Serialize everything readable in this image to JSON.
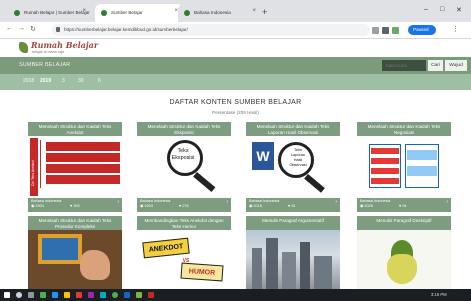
{
  "browser": {
    "tabs": [
      {
        "label": "Rumah Belajar | Sumber Belajar"
      },
      {
        "label": "Sumber Belajar"
      },
      {
        "label": "Bahasa Indonesia"
      }
    ],
    "new_tab": "+",
    "window_controls": {
      "minimize": "–",
      "maximize": "□",
      "close": "✕"
    },
    "url": "https://sumberbelajar.belajar.kemdikbud.go.id/sumberbelajar/",
    "profile_label": "Paused"
  },
  "site": {
    "logo_text": "Rumah Belajar",
    "logo_sub": "belajar di mana saja",
    "title": "SUMBER BELAJAR",
    "search_placeholder": "Kata Kunci",
    "search_button": "Cari",
    "filter_button": "Wujud",
    "years": [
      "2018",
      "2019",
      "3",
      "30",
      "6"
    ]
  },
  "content": {
    "heading": "DAFTAR KONTEN SUMBER BELAJAR",
    "subheading": "Persentase (209 Hasil)",
    "cards": [
      {
        "title": "Menelaah Struktur dan Kaidah Teks Anekdot",
        "subject": "Bahasa Indonesia",
        "views": "1904",
        "likes": "309",
        "thumb": "anekdot-chart"
      },
      {
        "title": "Menelaah Struktur dan Kaidah Teks Eksposisi",
        "subject": "Bahasa Indonesia",
        "views": "1903",
        "likes": "278",
        "thumb": "eksposisi"
      },
      {
        "title": "Menelaah Struktur dan Kaidah Teks Laporan Hasil Observasi",
        "subject": "Bahasa Indonesia",
        "views": "2015",
        "likes": "91",
        "thumb": "observasi"
      },
      {
        "title": "Menelaah Struktur dan Kaidah Teks Negosiasi",
        "subject": "Bahasa Indonesia",
        "views": "2025",
        "likes": "94",
        "thumb": "negosiasi"
      },
      {
        "title": "Menelaah Struktur dan Kaidah Teks Prosedur Kompleks",
        "thumb": "atm"
      },
      {
        "title": "Membandingkan Teks Anekdot dengan Teks Humor",
        "thumb": "anekdot-humor",
        "thumb_text": [
          "ANEKDOT",
          "VS",
          "HUMOR"
        ]
      },
      {
        "title": "Menulis Paragraf Argumentatif",
        "thumb": "city"
      },
      {
        "title": "Menulis Paragraf Deskriptif",
        "thumb": "grape"
      }
    ]
  },
  "thumb_text": {
    "eksposisi": [
      "Teks",
      "Eksposisi"
    ],
    "observasi": [
      "Teks",
      "Laporan",
      "Hasil",
      "Observasi"
    ],
    "anekdot_side": "Ciri Teks Anekdot"
  },
  "taskbar": {
    "time": "3:16 PM"
  },
  "colors": {
    "accent": "#7c9a7c",
    "year_bar": "#9fbfa5",
    "card": "#7e9c80"
  }
}
